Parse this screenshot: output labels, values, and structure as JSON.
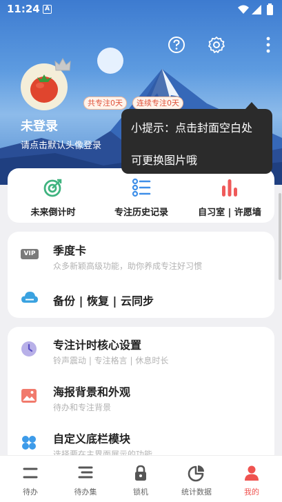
{
  "status_bar": {
    "time": "11:24",
    "app_icon_letter": "A"
  },
  "header": {
    "help_icon": "help-circle-icon",
    "settings_icon": "gear-icon",
    "more_icon": "more-vert-icon"
  },
  "profile": {
    "name": "未登录",
    "subtitle": "请点击默认头像登录",
    "total_focus": "共专注0天",
    "streak_focus": "连续专注0天"
  },
  "tooltip": {
    "line1": "小提示：点击封面空白处",
    "line2": "可更换图片哦"
  },
  "quick_actions": [
    {
      "label": "未来倒计时",
      "icon": "target-icon",
      "color": "#3fb37f"
    },
    {
      "label": "专注历史记录",
      "icon": "list-icon",
      "color": "#3d8ee8"
    },
    {
      "label": "自习室 | 许愿墙",
      "icon": "bar-chart-icon",
      "color": "#ef5a5a"
    }
  ],
  "section1": [
    {
      "title": "季度卡",
      "subtitle": "众多新颖高级功能，助你养成专注好习惯",
      "icon": "vip-icon",
      "icon_text": "VIP"
    },
    {
      "title": "备份 | 恢复 | 云同步",
      "icon": "cloud-icon"
    }
  ],
  "section2": [
    {
      "title": "专注计时核心设置",
      "subtitle": "铃声震动 | 专注格言 | 休息时长",
      "icon": "clock-icon"
    },
    {
      "title": "海报背景和外观",
      "subtitle": "待办和专注背景",
      "icon": "image-icon"
    },
    {
      "title": "自定义底栏模块",
      "subtitle": "选择要在主界面展示的功能",
      "icon": "grid-icon"
    }
  ],
  "bottom_nav": [
    {
      "label": "待办",
      "icon": "todo-icon"
    },
    {
      "label": "待办集",
      "icon": "todo-set-icon"
    },
    {
      "label": "锁机",
      "icon": "lock-icon"
    },
    {
      "label": "统计数据",
      "icon": "pie-chart-icon"
    },
    {
      "label": "我的",
      "icon": "person-icon",
      "active": true
    }
  ],
  "colors": {
    "accent": "#ef5350",
    "hero_blue": "#4a86d6"
  }
}
